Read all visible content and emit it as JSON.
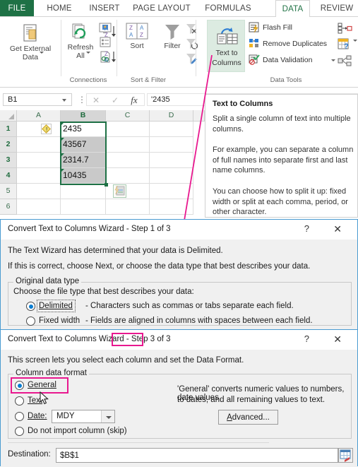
{
  "ribbon": {
    "tabs": [
      {
        "label": "FILE",
        "active": false,
        "file": true
      },
      {
        "label": "HOME",
        "active": false
      },
      {
        "label": "INSERT",
        "active": false
      },
      {
        "label": "PAGE LAYOUT",
        "active": false
      },
      {
        "label": "FORMULAS",
        "active": false
      },
      {
        "label": "DATA",
        "active": true
      },
      {
        "label": "REVIEW",
        "active": false
      }
    ],
    "groups": [
      {
        "label": "Connections"
      },
      {
        "label": "Sort & Filter"
      },
      {
        "label": "Data Tools"
      }
    ],
    "buttons": {
      "get_external_data": "Get External\nData",
      "get_external_data_l1": "Get External",
      "get_external_data_l2": "Data",
      "refresh_all_l1": "Refresh",
      "refresh_all_l2": "All",
      "sort": "Sort",
      "filter": "Filter",
      "text_to_columns_l1": "Text to",
      "text_to_columns_l2": "Columns",
      "flash_fill": "Flash Fill",
      "remove_duplicates": "Remove Duplicates",
      "data_validation": "Data Validation"
    }
  },
  "formula_bar": {
    "name_box": "B1",
    "formula": "'2435"
  },
  "sheet": {
    "columns": [
      "A",
      "B",
      "C",
      "D"
    ],
    "rows": [
      "1",
      "2",
      "3",
      "4",
      "5",
      "6"
    ],
    "selected_column": "B",
    "cells_b": [
      "2435",
      "43567",
      "2314.7",
      "10435"
    ]
  },
  "tooltip": {
    "title": "Text to Columns",
    "paragraphs": [
      "Split a single column of text into multiple columns.",
      "For example, you can separate a column of full names into separate first and last name columns.",
      "You can choose how to split it up: fixed width or split at each comma, period, or other character."
    ]
  },
  "dialog1": {
    "title": "Convert Text to Columns Wizard - Step 1 of 3",
    "help_glyph": "?",
    "close_glyph": "✕",
    "line1": "The Text Wizard has determined that your data is Delimited.",
    "line2": "If this is correct, choose Next, or choose the data type that best describes your data.",
    "group_label": "Original data type",
    "prompt": "Choose the file type that best describes your data:",
    "options": [
      {
        "label": "Delimited",
        "desc": "- Characters such as commas or tabs separate each field.",
        "selected": true
      },
      {
        "label": "Fixed width",
        "desc": "- Fields are aligned in columns with spaces between each field.",
        "selected": false
      }
    ]
  },
  "dialog2": {
    "title_pre": "Convert Text to Columns Wizard - ",
    "title_hl": "Step 3",
    "title_post": " of 3",
    "help_glyph": "?",
    "close_glyph": "✕",
    "line1": "This screen lets you select each column and set the Data Format.",
    "group_label": "Column data format",
    "options": [
      {
        "label": "General",
        "selected": true
      },
      {
        "label": "Text",
        "selected": false
      },
      {
        "label": "Date:",
        "selected": false
      },
      {
        "label": "Do not import column (skip)",
        "selected": false
      }
    ],
    "date_format": "MDY",
    "desc_line1": "'General' converts numeric values to numbers, date values",
    "desc_line2": "to dates, and all remaining values to text.",
    "advanced_button": "Advanced...",
    "destination_label": "Destination:",
    "destination_value": "$B$1"
  },
  "colors": {
    "accent_green": "#1e7145",
    "tab_active": "#217346",
    "highlight_magenta": "#e8188f",
    "dialog_border": "#4a9bd1",
    "radio_blue": "#0a7dd1"
  }
}
